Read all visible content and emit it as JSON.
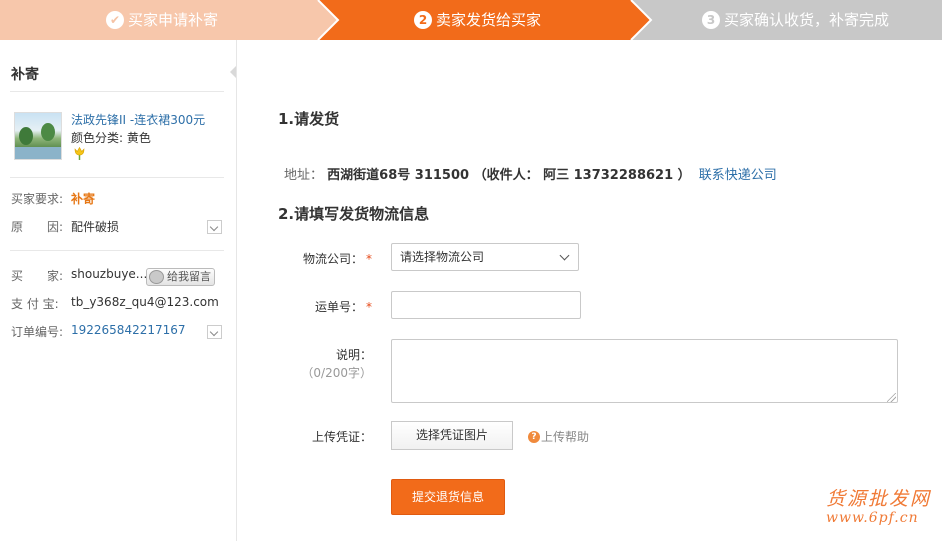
{
  "steps": [
    {
      "num": "✔",
      "label": "买家申请补寄",
      "state": "done"
    },
    {
      "num": "2",
      "label": "卖家发货给买家",
      "state": "active"
    },
    {
      "num": "3",
      "label": "买家确认收货，补寄完成",
      "state": "pending"
    }
  ],
  "colors": {
    "step_done": "#f7c7ab",
    "step_active": "#f26b1a",
    "step_pending": "#c8c8c8",
    "link": "#2d6fa8",
    "accent": "#e67817"
  },
  "sidebar": {
    "title": "补寄",
    "product": {
      "name": "法政先锋II -连衣裙300元",
      "spec": "颜色分类: 黄色",
      "badge_icon": "tulip-icon"
    },
    "request_label": "买家要求:",
    "request_value": "补寄",
    "reason_label": "原　　因:",
    "reason_value": "配件破损",
    "buyer_label": "买　　家:",
    "buyer_value": "shouzbuye...",
    "message_button": "给我留言",
    "alipay_label": "支 付 宝:",
    "alipay_value": "tb_y368z_qu4@123.com",
    "order_label": "订单编号:",
    "order_value": "192265842217167"
  },
  "main": {
    "section1_title": "1.请发货",
    "address_label": "地址：",
    "address_value": "西湖街道68号 311500 （收件人： 阿三 13732288621 ）",
    "contact_link": "联系快递公司",
    "section2_title": "2.请填写发货物流信息",
    "form": {
      "logistics_label": "物流公司：",
      "logistics_value": "请选择物流公司",
      "waybill_label": "运单号：",
      "waybill_value": "",
      "desc_label": "说明：",
      "desc_counter": "（0/200字）",
      "desc_value": "",
      "upload_label": "上传凭证：",
      "upload_button": "选择凭证图片",
      "upload_help": "上传帮助",
      "required_mark": "*"
    },
    "submit_button": "提交退货信息"
  },
  "watermark": {
    "cn": "货源批发网",
    "url": "www.6pf.cn"
  }
}
